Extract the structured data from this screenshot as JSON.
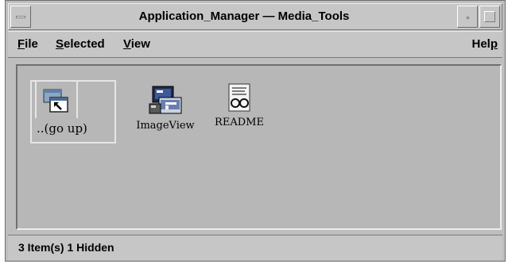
{
  "window": {
    "title": "Application_Manager — Media_Tools"
  },
  "menubar": {
    "file_mnemonic": "F",
    "file_rest": "ile",
    "selected_mnemonic": "S",
    "selected_rest": "elected",
    "view_mnemonic": "V",
    "view_rest": "iew",
    "help_rest": "Hel",
    "help_mnemonic": "p"
  },
  "files": {
    "items": [
      {
        "label": "..(go up)",
        "icon": "go-up-folder-icon",
        "selected": true
      },
      {
        "label": "ImageView",
        "icon": "image-viewer-app-icon",
        "selected": false
      },
      {
        "label": "README",
        "icon": "readme-document-icon",
        "selected": false
      }
    ]
  },
  "status": {
    "text": "3 Item(s) 1 Hidden"
  },
  "colors": {
    "window_bg": "#bebebe",
    "file_area_bg": "#b7b7b7",
    "selection_outline": "#e6e6e6"
  }
}
